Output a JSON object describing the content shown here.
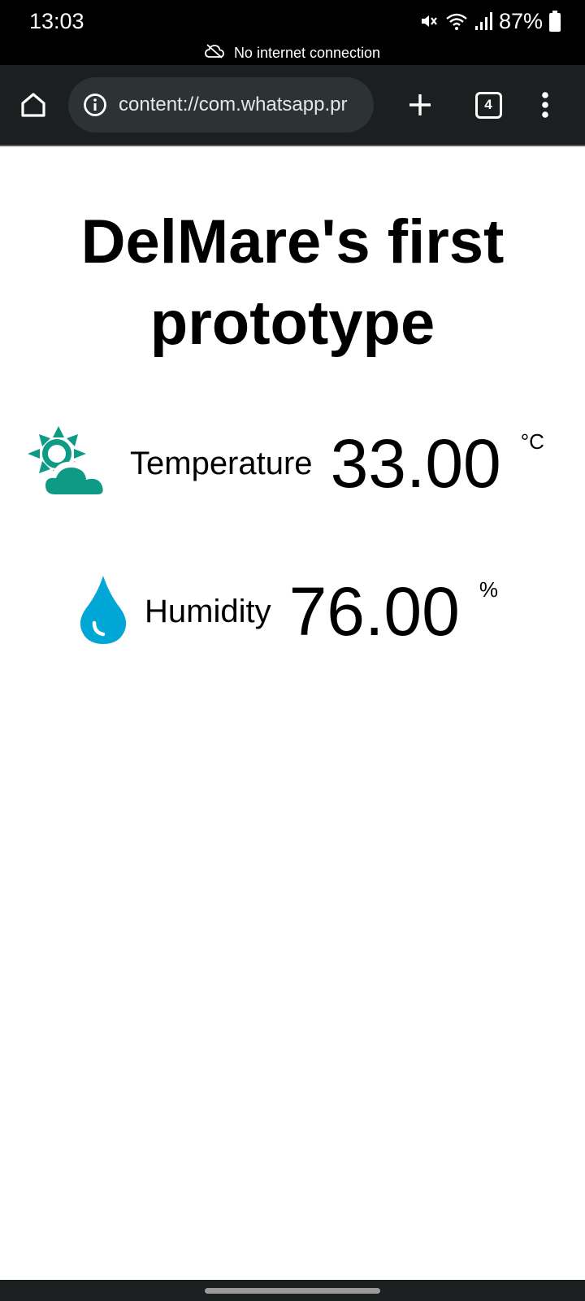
{
  "status_bar": {
    "time": "13:03",
    "battery": "87%",
    "offline_message": "No internet connection",
    "icons": [
      "mute-icon",
      "wifi-icon",
      "signal-icon",
      "battery-icon",
      "cloud-off-icon"
    ]
  },
  "browser": {
    "url": "content://com.whatsapp.pr",
    "tab_count": "4",
    "icons": [
      "home-icon",
      "info-icon",
      "plus-icon",
      "more-vert-icon"
    ]
  },
  "page": {
    "title": "DelMare's first prototype",
    "readings": [
      {
        "label": "Temperature",
        "value": "33.00",
        "unit": "°C",
        "icon": "sun-cloud-icon",
        "icon_color": "#0d9b86"
      },
      {
        "label": "Humidity",
        "value": "76.00",
        "unit": "%",
        "icon": "water-drop-icon",
        "icon_color": "#00a6d6"
      }
    ]
  },
  "colors": {
    "status_bar_bg": "#000000",
    "browser_bar_bg": "#1b1f20",
    "url_box_bg": "#2c3335",
    "page_bg": "#ffffff"
  }
}
